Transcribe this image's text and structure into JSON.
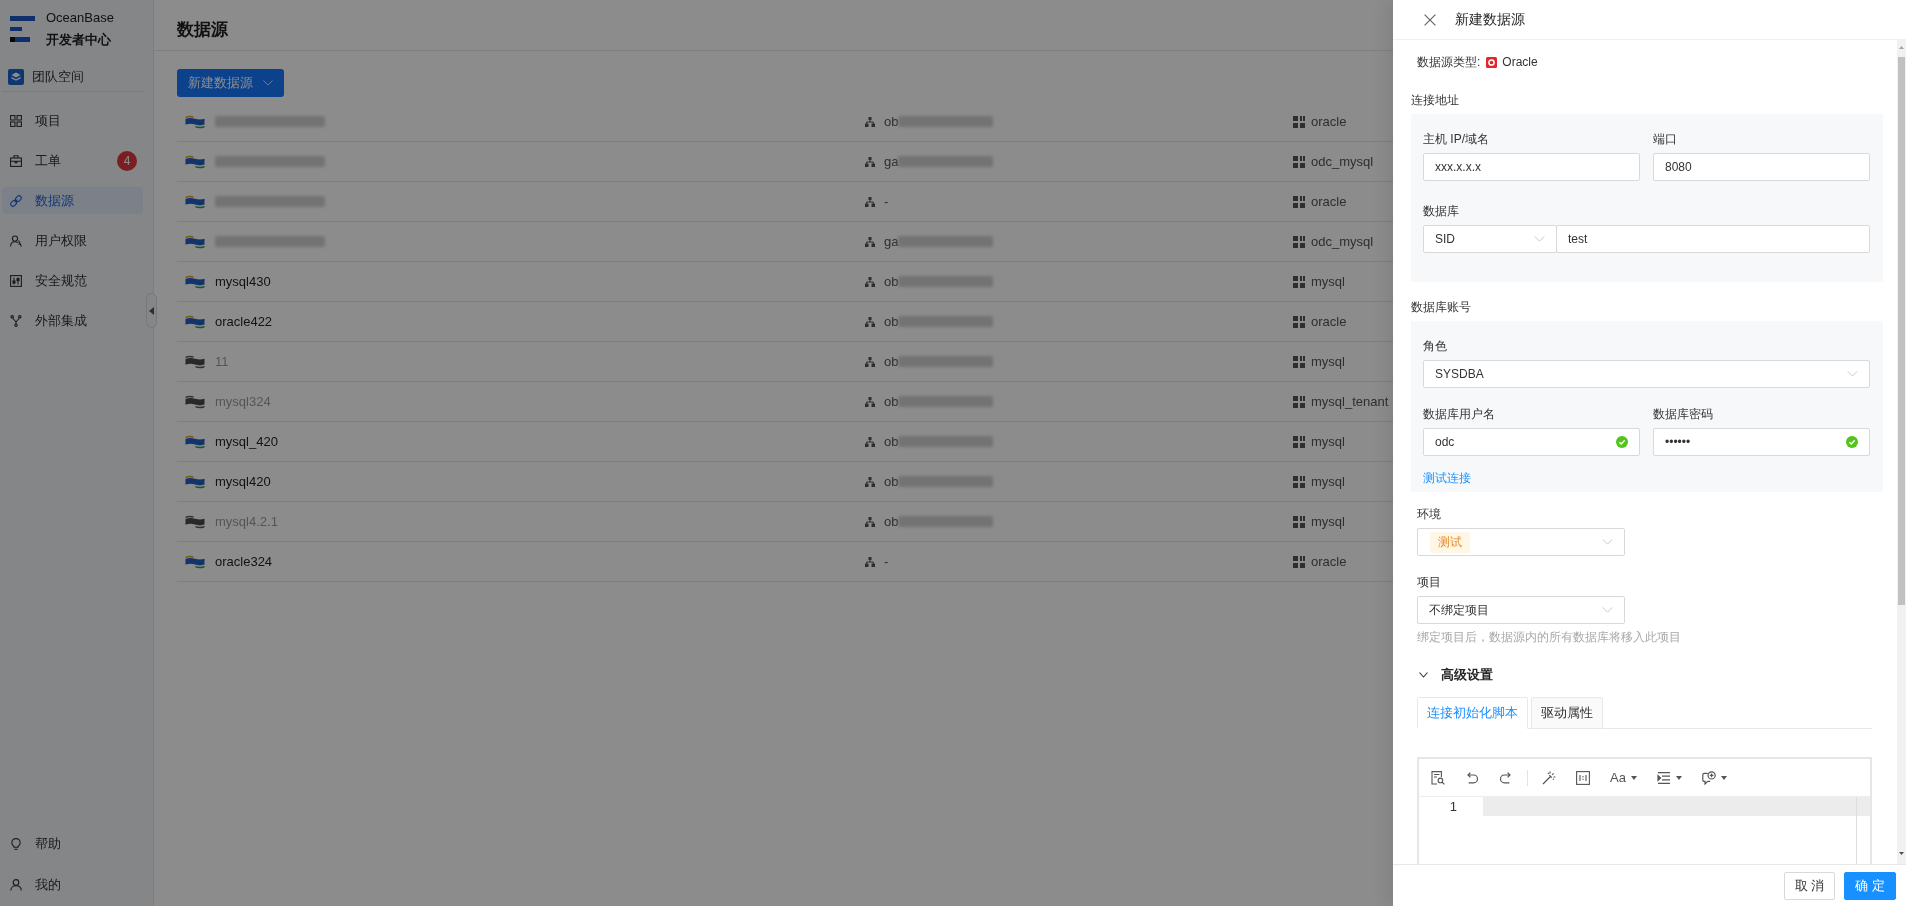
{
  "sidebar": {
    "brand": {
      "name": "OceanBase",
      "subtitle": "开发者中心"
    },
    "team_space": "团队空间",
    "items": [
      {
        "kind": "project",
        "label": "项目",
        "selected": false
      },
      {
        "kind": "ticket",
        "label": "工单",
        "selected": false,
        "badge": "4"
      },
      {
        "kind": "datasource",
        "label": "数据源",
        "selected": true
      },
      {
        "kind": "user",
        "label": "用户权限",
        "selected": false
      },
      {
        "kind": "security",
        "label": "安全规范",
        "selected": false
      },
      {
        "kind": "integration",
        "label": "外部集成",
        "selected": false
      }
    ],
    "bottom_items": [
      {
        "kind": "help",
        "label": "帮助",
        "selected": false
      },
      {
        "kind": "me",
        "label": "我的",
        "selected": false
      }
    ]
  },
  "main": {
    "title": "数据源",
    "new_button": "新建数据源",
    "rows": [
      {
        "name_blurred": true,
        "cluster": "ob",
        "cluster_blurred": true,
        "tenant": "oracle",
        "disabled": false
      },
      {
        "name_blurred": true,
        "cluster": "ga",
        "cluster_blurred": true,
        "tenant": "odc_mysql",
        "disabled": false
      },
      {
        "name_blurred": true,
        "cluster": "-",
        "cluster_blurred": false,
        "tenant": "oracle",
        "disabled": false
      },
      {
        "name_blurred": true,
        "cluster": "ga",
        "cluster_blurred": true,
        "tenant": "odc_mysql",
        "disabled": false
      },
      {
        "name": "mysql430",
        "name_blurred": false,
        "cluster": "ob",
        "cluster_blurred": true,
        "tenant": "mysql",
        "disabled": false
      },
      {
        "name": "oracle422",
        "name_blurred": false,
        "cluster": "ob",
        "cluster_blurred": true,
        "tenant": "oracle",
        "disabled": false
      },
      {
        "name": "11",
        "name_blurred": false,
        "cluster": "ob",
        "cluster_blurred": true,
        "tenant": "mysql",
        "disabled": true
      },
      {
        "name": "mysql324",
        "name_blurred": false,
        "cluster": "ob",
        "cluster_blurred": true,
        "tenant": "mysql_tenant",
        "disabled": true
      },
      {
        "name": "mysql_420",
        "name_blurred": false,
        "cluster": "ob",
        "cluster_blurred": true,
        "tenant": "mysql",
        "disabled": false
      },
      {
        "name": "mysql420",
        "name_blurred": false,
        "cluster": "ob",
        "cluster_blurred": true,
        "tenant": "mysql",
        "disabled": false
      },
      {
        "name": "mysql4.2.1",
        "name_blurred": false,
        "cluster": "ob",
        "cluster_blurred": true,
        "tenant": "mysql",
        "disabled": true
      },
      {
        "name": "oracle324",
        "name_blurred": false,
        "cluster": "-",
        "cluster_blurred": false,
        "tenant": "oracle",
        "disabled": false
      }
    ]
  },
  "drawer": {
    "title": "新建数据源",
    "type": {
      "label": "数据源类型:",
      "value": "Oracle"
    },
    "connection": {
      "heading": "连接地址",
      "host": {
        "label": "主机 IP/域名",
        "value": "xxx.x.x.x"
      },
      "port": {
        "label": "端口",
        "value": "8080"
      },
      "database": {
        "label": "数据库",
        "mode": "SID",
        "value": "test"
      }
    },
    "account": {
      "heading": "数据库账号",
      "role": {
        "label": "角色",
        "value": "SYSDBA"
      },
      "username": {
        "label": "数据库用户名",
        "value": "odc",
        "valid": true
      },
      "password": {
        "label": "数据库密码",
        "value": "••••••",
        "valid": true
      },
      "test_link": "测试连接"
    },
    "environment": {
      "label": "环境",
      "tag": "测试"
    },
    "project": {
      "label": "项目",
      "value": "不绑定项目",
      "help": "绑定项目后，数据源内的所有数据库将移入此项目"
    },
    "advanced": {
      "label": "高级设置",
      "expanded": true,
      "tabs": [
        {
          "label": "连接初始化脚本",
          "selected": true
        },
        {
          "label": "驱动属性",
          "selected": false
        }
      ],
      "editor": {
        "case_button": "Aa",
        "line_numbers": [
          "1"
        ]
      }
    },
    "buttons": {
      "cancel": "取 消",
      "ok": "确 定"
    }
  }
}
